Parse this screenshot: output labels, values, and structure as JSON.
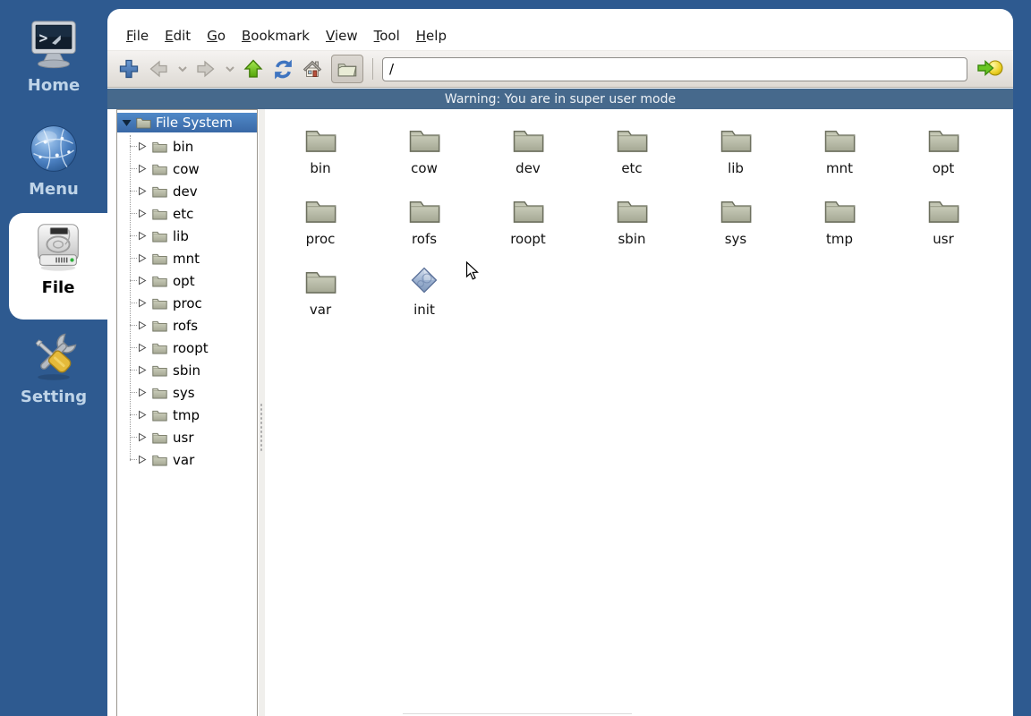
{
  "colors": {
    "frame_blue": "#2e5a90",
    "selection_blue_top": "#5089c8",
    "selection_blue_bottom": "#3968a6",
    "warning_bar": "#46698c",
    "toolbar_gray": "#e4e0db",
    "folder_body": "#b9bca9"
  },
  "sidebar": {
    "items": [
      {
        "label": "Home",
        "icon": "terminal-monitor-icon",
        "active": false
      },
      {
        "label": "Menu",
        "icon": "globe-icon",
        "active": false
      },
      {
        "label": "File",
        "icon": "hard-drive-icon",
        "active": true
      },
      {
        "label": "Setting",
        "icon": "tools-icon",
        "active": false
      }
    ]
  },
  "window": {
    "menu": {
      "items": [
        {
          "label": "File"
        },
        {
          "label": "Edit"
        },
        {
          "label": "Go"
        },
        {
          "label": "Bookmark"
        },
        {
          "label": "View"
        },
        {
          "label": "Tool"
        },
        {
          "label": "Help"
        }
      ]
    },
    "toolbar": {
      "buttons": [
        "new-tab",
        "back",
        "back-history",
        "forward",
        "forward-history",
        "go-up",
        "refresh",
        "go-home",
        "side-pane-toggle"
      ],
      "path_value": "/",
      "go_button": "jump-to"
    },
    "warning": {
      "text": "Warning: You are in super user mode"
    },
    "tree": {
      "root": {
        "label": "File System",
        "expanded": true,
        "selected": true
      },
      "children": [
        "bin",
        "cow",
        "dev",
        "etc",
        "lib",
        "mnt",
        "opt",
        "proc",
        "rofs",
        "roopt",
        "sbin",
        "sys",
        "tmp",
        "usr",
        "var"
      ]
    },
    "files": {
      "items": [
        {
          "name": "bin",
          "type": "folder"
        },
        {
          "name": "cow",
          "type": "folder"
        },
        {
          "name": "dev",
          "type": "folder"
        },
        {
          "name": "etc",
          "type": "folder"
        },
        {
          "name": "lib",
          "type": "folder"
        },
        {
          "name": "mnt",
          "type": "folder"
        },
        {
          "name": "opt",
          "type": "folder"
        },
        {
          "name": "proc",
          "type": "folder"
        },
        {
          "name": "rofs",
          "type": "folder"
        },
        {
          "name": "roopt",
          "type": "folder"
        },
        {
          "name": "sbin",
          "type": "folder"
        },
        {
          "name": "sys",
          "type": "folder"
        },
        {
          "name": "tmp",
          "type": "folder"
        },
        {
          "name": "usr",
          "type": "folder"
        },
        {
          "name": "var",
          "type": "folder"
        },
        {
          "name": "init",
          "type": "executable"
        }
      ]
    }
  }
}
